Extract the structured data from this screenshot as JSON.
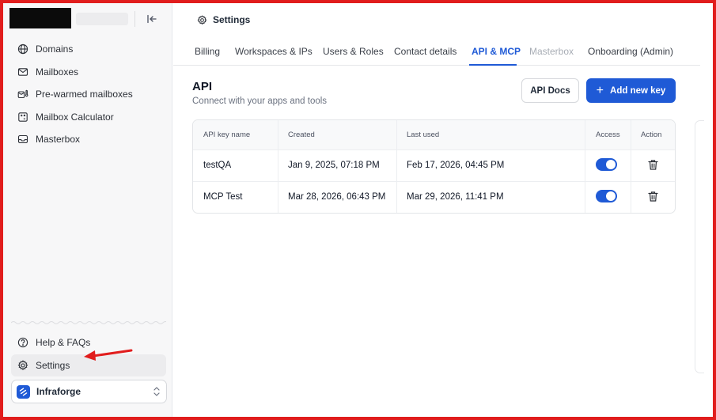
{
  "sidebar": {
    "items": [
      {
        "label": "Domains",
        "icon": "globe-icon"
      },
      {
        "label": "Mailboxes",
        "icon": "mail-icon"
      },
      {
        "label": "Pre-warmed mailboxes",
        "icon": "warm-mailbox-icon"
      },
      {
        "label": "Mailbox Calculator",
        "icon": "calculator-icon"
      },
      {
        "label": "Masterbox",
        "icon": "inbox-icon"
      }
    ],
    "bottom_items": [
      {
        "label": "Help & FAQs",
        "icon": "help-icon"
      },
      {
        "label": "Settings",
        "icon": "gear-icon",
        "active": true
      }
    ],
    "workspace": {
      "name": "Infraforge",
      "logo": "infraforge-logo"
    }
  },
  "header": {
    "title": "Settings",
    "icon": "gear-icon"
  },
  "tabs": [
    {
      "label": "Billing"
    },
    {
      "label": "Workspaces & IPs"
    },
    {
      "label": "Users & Roles"
    },
    {
      "label": "Contact details"
    },
    {
      "label": "API & MCP",
      "active": true
    },
    {
      "label": "Masterbox",
      "disabled": true
    },
    {
      "label": "Onboarding (Admin)"
    }
  ],
  "api": {
    "title": "API",
    "subtitle": "Connect with your apps and tools",
    "docs_label": "API Docs",
    "add_label": "Add new key"
  },
  "table": {
    "columns": [
      "API key name",
      "Created",
      "Last used",
      "Access",
      "Action"
    ],
    "rows": [
      {
        "name": "testQA",
        "created": "Jan 9, 2025, 07:18 PM",
        "last_used": "Feb 17, 2026, 04:45 PM",
        "access": true
      },
      {
        "name": "MCP Test",
        "created": "Mar 28, 2026, 06:43 PM",
        "last_used": "Mar 29, 2026, 11:41 PM",
        "access": true
      }
    ]
  },
  "colors": {
    "accent": "#1f5ad6",
    "annotation": "#e11d1d"
  }
}
